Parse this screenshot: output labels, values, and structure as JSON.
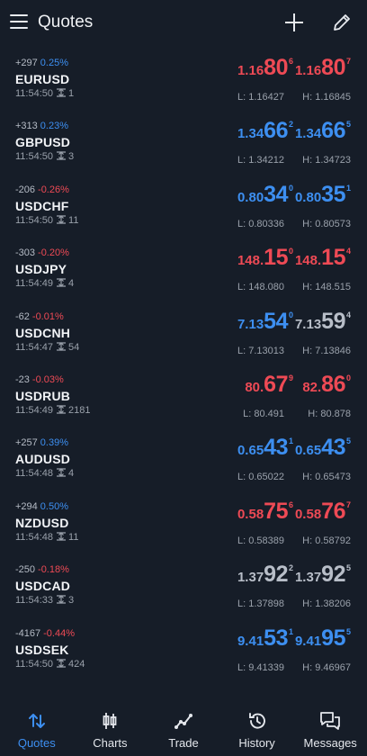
{
  "header": {
    "title": "Quotes"
  },
  "quotes": [
    {
      "change_abs": "+297",
      "change_pct": "0.25%",
      "dir": "pos",
      "symbol": "EURUSD",
      "time": "11:54:50",
      "spread": "1",
      "bid": {
        "small": "1.16",
        "big": "80",
        "sup": "6",
        "color": "down"
      },
      "ask": {
        "small": "1.16",
        "big": "80",
        "sup": "7",
        "color": "down"
      },
      "low": "L: 1.16427",
      "high": "H: 1.16845"
    },
    {
      "change_abs": "+313",
      "change_pct": "0.23%",
      "dir": "pos",
      "symbol": "GBPUSD",
      "time": "11:54:50",
      "spread": "3",
      "bid": {
        "small": "1.34",
        "big": "66",
        "sup": "2",
        "color": "up"
      },
      "ask": {
        "small": "1.34",
        "big": "66",
        "sup": "5",
        "color": "up"
      },
      "low": "L: 1.34212",
      "high": "H: 1.34723"
    },
    {
      "change_abs": "-206",
      "change_pct": "-0.26%",
      "dir": "neg",
      "symbol": "USDCHF",
      "time": "11:54:50",
      "spread": "11",
      "bid": {
        "small": "0.80",
        "big": "34",
        "sup": "0",
        "color": "up"
      },
      "ask": {
        "small": "0.80",
        "big": "35",
        "sup": "1",
        "color": "up"
      },
      "low": "L: 0.80336",
      "high": "H: 0.80573"
    },
    {
      "change_abs": "-303",
      "change_pct": "-0.20%",
      "dir": "neg",
      "symbol": "USDJPY",
      "time": "11:54:49",
      "spread": "4",
      "bid": {
        "small": "148.",
        "big": "15",
        "sup": "0",
        "color": "down"
      },
      "ask": {
        "small": "148.",
        "big": "15",
        "sup": "4",
        "color": "down"
      },
      "low": "L: 148.080",
      "high": "H: 148.515"
    },
    {
      "change_abs": "-62",
      "change_pct": "-0.01%",
      "dir": "neg",
      "symbol": "USDCNH",
      "time": "11:54:47",
      "spread": "54",
      "bid": {
        "small": "7.13",
        "big": "54",
        "sup": "0",
        "color": "up"
      },
      "ask": {
        "small": "7.13",
        "big": "59",
        "sup": "4",
        "color": "flat"
      },
      "low": "L: 7.13013",
      "high": "H: 7.13846"
    },
    {
      "change_abs": "-23",
      "change_pct": "-0.03%",
      "dir": "neg",
      "symbol": "USDRUB",
      "time": "11:54:49",
      "spread": "2181",
      "bid": {
        "small": "80.",
        "big": "67",
        "sup": "9",
        "color": "down"
      },
      "ask": {
        "small": "82.",
        "big": "86",
        "sup": "0",
        "color": "down"
      },
      "low": "L: 80.491",
      "high": "H: 80.878"
    },
    {
      "change_abs": "+257",
      "change_pct": "0.39%",
      "dir": "pos",
      "symbol": "AUDUSD",
      "time": "11:54:48",
      "spread": "4",
      "bid": {
        "small": "0.65",
        "big": "43",
        "sup": "1",
        "color": "up"
      },
      "ask": {
        "small": "0.65",
        "big": "43",
        "sup": "5",
        "color": "up"
      },
      "low": "L: 0.65022",
      "high": "H: 0.65473"
    },
    {
      "change_abs": "+294",
      "change_pct": "0.50%",
      "dir": "pos",
      "symbol": "NZDUSD",
      "time": "11:54:48",
      "spread": "11",
      "bid": {
        "small": "0.58",
        "big": "75",
        "sup": "6",
        "color": "down"
      },
      "ask": {
        "small": "0.58",
        "big": "76",
        "sup": "7",
        "color": "down"
      },
      "low": "L: 0.58389",
      "high": "H: 0.58792"
    },
    {
      "change_abs": "-250",
      "change_pct": "-0.18%",
      "dir": "neg",
      "symbol": "USDCAD",
      "time": "11:54:33",
      "spread": "3",
      "bid": {
        "small": "1.37",
        "big": "92",
        "sup": "2",
        "color": "flat"
      },
      "ask": {
        "small": "1.37",
        "big": "92",
        "sup": "5",
        "color": "flat"
      },
      "low": "L: 1.37898",
      "high": "H: 1.38206"
    },
    {
      "change_abs": "-4167",
      "change_pct": "-0.44%",
      "dir": "neg",
      "symbol": "USDSEK",
      "time": "11:54:50",
      "spread": "424",
      "bid": {
        "small": "9.41",
        "big": "53",
        "sup": "1",
        "color": "up"
      },
      "ask": {
        "small": "9.41",
        "big": "95",
        "sup": "5",
        "color": "up"
      },
      "low": "L: 9.41339",
      "high": "H: 9.46967"
    }
  ],
  "tabs": [
    {
      "label": "Quotes",
      "icon": "quotes-icon",
      "active": true
    },
    {
      "label": "Charts",
      "icon": "charts-icon",
      "active": false
    },
    {
      "label": "Trade",
      "icon": "trade-icon",
      "active": false
    },
    {
      "label": "History",
      "icon": "history-icon",
      "active": false
    },
    {
      "label": "Messages",
      "icon": "messages-icon",
      "active": false
    }
  ],
  "colors": {
    "background": "#161d28",
    "up": "#3d8ff1",
    "down": "#ee4a55",
    "flat": "#b8bec8"
  }
}
